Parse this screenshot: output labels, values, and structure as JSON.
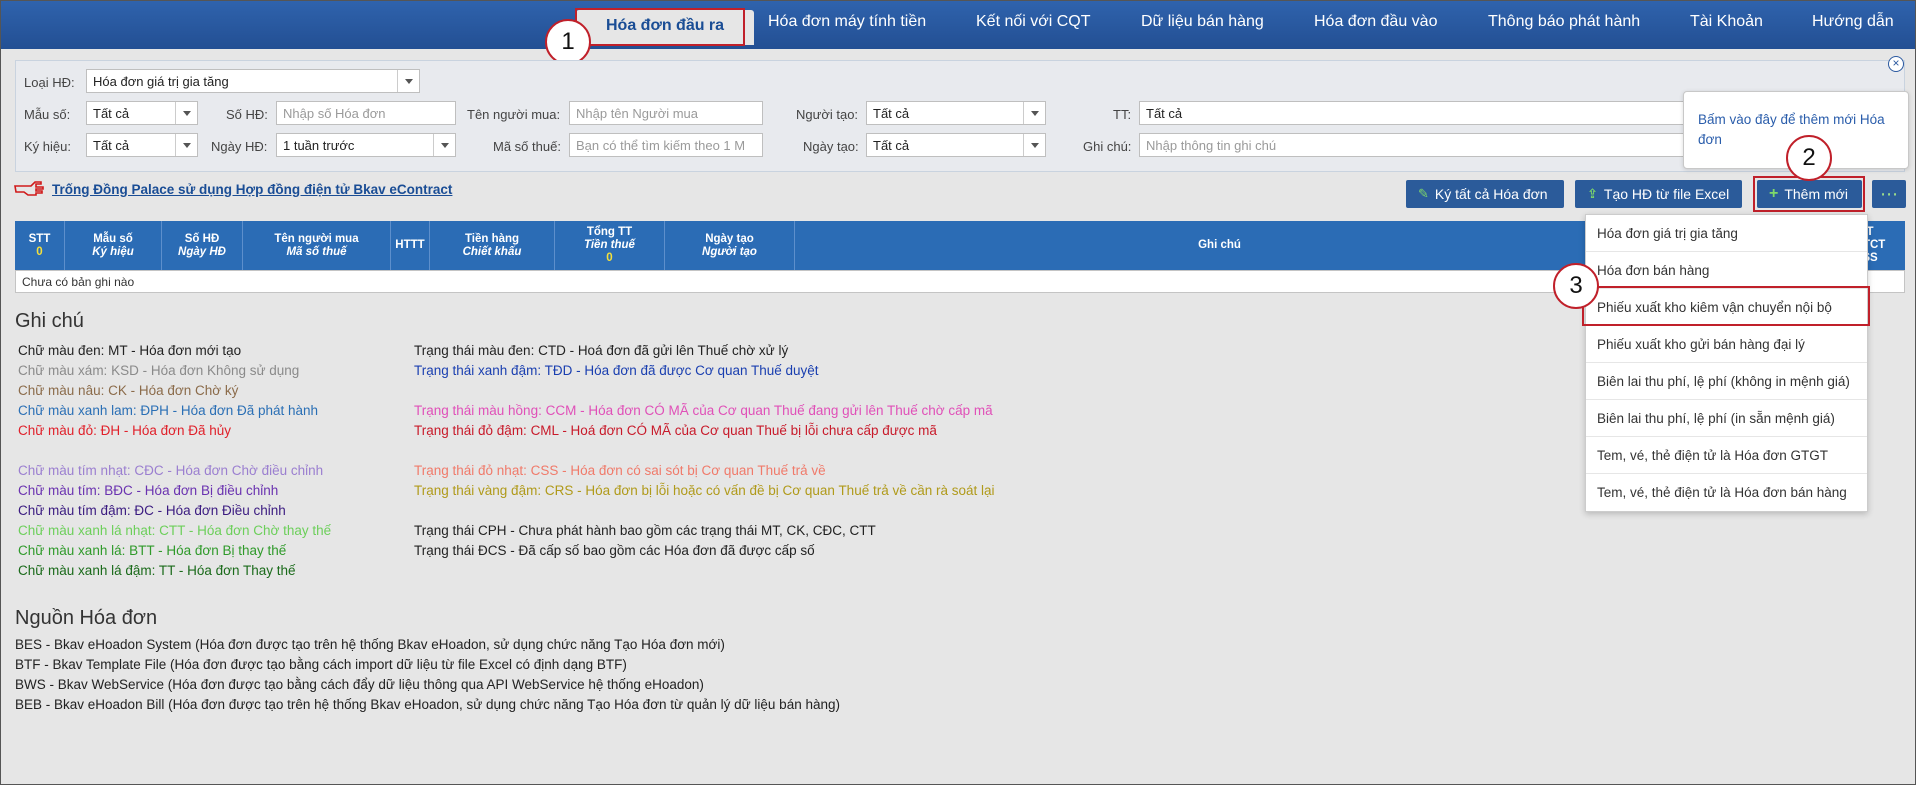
{
  "nav": {
    "tabs": [
      {
        "label": "Hóa đơn đầu ra",
        "active": true
      },
      {
        "label": "Hóa đơn máy tính tiền"
      },
      {
        "label": "Kết nối với CQT"
      },
      {
        "label": "Dữ liệu bán hàng"
      },
      {
        "label": "Hóa đơn đầu vào"
      },
      {
        "label": "Thông báo phát hành"
      },
      {
        "label": "Tài Khoản"
      },
      {
        "label": "Hướng dẫn"
      }
    ]
  },
  "steps": [
    "1",
    "2",
    "3"
  ],
  "filters": {
    "loai_hd_label": "Loại HĐ:",
    "loai_hd_value": "Hóa đơn giá trị gia tăng",
    "mau_so_label": "Mẫu số:",
    "mau_so_value": "Tất cả",
    "so_hd_label": "Số HĐ:",
    "so_hd_placeholder": "Nhập số Hóa đơn",
    "ten_nguoi_mua_label": "Tên người mua:",
    "ten_nguoi_mua_placeholder": "Nhập tên Người mua",
    "nguoi_tao_label": "Người tạo:",
    "nguoi_tao_value": "Tất cả",
    "tt_label": "TT:",
    "tt_value": "Tất cả",
    "ky_hieu_label": "Ký hiệu:",
    "ky_hieu_value": "Tất cả",
    "ngay_hd_label": "Ngày HĐ:",
    "ngay_hd_value": "1 tuần trước",
    "ma_so_thue_label": "Mã số thuế:",
    "ma_so_thue_placeholder": "Bạn có thể tìm kiếm theo 1 M",
    "ngay_tao_label": "Ngày tạo:",
    "ngay_tao_value": "Tất cả",
    "ghi_chu_label": "Ghi chú:",
    "ghi_chu_placeholder": "Nhập thông tin ghi chú"
  },
  "tooltip": "Bấm vào đây để thêm mới Hóa đơn",
  "promo_link": "Trống Đồng Palace sử dụng Hợp đồng điện tử Bkav eContract",
  "buttons": {
    "ky_tat_ca": "Ký tất cả Hóa đơn",
    "tao_excel": "Tạo HĐ từ file Excel",
    "them_moi": "Thêm mới",
    "more": "⋯"
  },
  "table": {
    "headers": [
      {
        "l1": "STT",
        "l2": "0",
        "l2_count": true
      },
      {
        "l1": "Mẫu số",
        "l2": "Ký hiệu"
      },
      {
        "l1": "Số HĐ",
        "l2": "Ngày HĐ"
      },
      {
        "l1": "Tên người mua",
        "l2": "Mã số thuế"
      },
      {
        "l1": "HTTT",
        "l2": ""
      },
      {
        "l1": "Tiền hàng",
        "l2": "Chiết khấu"
      },
      {
        "l1": "Tổng TT",
        "l2": "Tiền thuế",
        "l3": "0"
      },
      {
        "l1": "Ngày tạo",
        "l2": "Người tạo"
      },
      {
        "l1": "Ghi chú",
        "l2": ""
      },
      {
        "l1": "T",
        "l2": "CTCT",
        "l3": "SS"
      }
    ],
    "empty_text": "Chưa có bản ghi nào"
  },
  "menu": [
    "Hóa đơn giá trị gia tăng",
    "Hóa đơn bán hàng",
    "Phiếu xuất kho kiêm vận chuyển nội bộ",
    "Phiếu xuất kho gửi bán hàng đại lý",
    "Biên lai thu phí, lệ phí (không in mệnh giá)",
    "Biên lai thu phí, lệ phí (in sẵn mệnh giá)",
    "Tem, vé, thẻ điện tử là Hóa đơn GTGT",
    "Tem, vé, thẻ điện tử là Hóa đơn bán hàng"
  ],
  "notes": {
    "title": "Ghi chú",
    "left": [
      {
        "text": "Chữ màu đen: MT - Hóa đơn mới tạo",
        "color": "#222222"
      },
      {
        "text": "Chữ màu xám: KSD - Hóa đơn Không sử dụng",
        "color": "#8a8a8a"
      },
      {
        "text": "Chữ màu nâu: CK - Hóa đơn Chờ ký",
        "color": "#8b6b4a"
      },
      {
        "text": "Chữ màu xanh lam: ĐPH - Hóa đơn Đã phát hành",
        "color": "#2a6fb5"
      },
      {
        "text": "Chữ màu đỏ: ĐH - Hóa đơn Đã hủy",
        "color": "#e0202a"
      },
      {
        "text": "Chữ màu tím nhạt: CĐC - Hóa đơn Chờ điều chỉnh",
        "color": "#9b7fd0"
      },
      {
        "text": "Chữ màu tím: BĐC - Hóa đơn Bị điều chỉnh",
        "color": "#6a32b0"
      },
      {
        "text": "Chữ màu tím đậm: ĐC - Hóa đơn Điều chỉnh",
        "color": "#3a1a80"
      },
      {
        "text": "Chữ màu xanh lá nhạt: CTT - Hóa đơn Chờ thay thế",
        "color": "#6ccf5a"
      },
      {
        "text": "Chữ màu xanh lá: BTT - Hóa đơn Bị thay thế",
        "color": "#2f9a2a"
      },
      {
        "text": "Chữ màu xanh lá đậm: TT - Hóa đơn Thay thế",
        "color": "#1a6a1a"
      }
    ],
    "right": [
      {
        "text": "Trạng thái màu đen: CTD - Hoá đơn đã gửi lên Thuế chờ xử lý",
        "color": "#222222"
      },
      {
        "text": "Trạng thái xanh đậm: TĐD - Hóa đơn đã được Cơ quan Thuế duyệt",
        "color": "#1a3fb0"
      },
      {
        "text": "Trạng thái màu hồng: CCM - Hóa đơn CÓ MÃ của Cơ quan Thuế đang gửi lên Thuế chờ cấp mã",
        "color": "#e050b8"
      },
      {
        "text": "Trạng thái đỏ đậm: CML - Hoá đơn CÓ MÃ của Cơ quan Thuế bị lỗi chưa cấp được mã",
        "color": "#c81a2a"
      },
      {
        "text": "Trạng thái đỏ nhạt: CSS - Hóa đơn có sai sót bị Cơ quan Thuế trả về",
        "color": "#f07a6a"
      },
      {
        "text": "Trạng thái vàng đậm: CRS - Hóa đơn bị lỗi hoặc có vấn đề bị Cơ quan Thuế trả về cần rà soát lại",
        "color": "#b09a1a"
      },
      {
        "text": "Trạng thái CPH - Chưa phát hành bao gồm các trạng thái MT, CK, CĐC, CTT",
        "color": "#222222"
      },
      {
        "text": "Trạng thái ĐCS - Đã cấp số bao gồm các Hóa đơn đã được cấp số",
        "color": "#222222"
      }
    ]
  },
  "sources": {
    "title": "Nguồn Hóa đơn",
    "items": [
      "BES - Bkav eHoadon System (Hóa đơn được tạo trên hệ thống Bkav eHoadon, sử dụng chức năng Tạo Hóa đơn mới)",
      "BTF - Bkav Template File (Hóa đơn được tạo bằng cách import dữ liệu từ file Excel có định dạng BTF)",
      "BWS - Bkav WebService (Hóa đơn được tạo bằng cách đẩy dữ liệu thông qua API WebService hệ thống eHoadon)",
      "BEB - Bkav eHoadon Bill (Hóa đơn được tạo trên hệ thống Bkav eHoadon, sử dụng chức năng Tạo Hóa đơn từ quản lý dữ liệu bán hàng)"
    ]
  }
}
